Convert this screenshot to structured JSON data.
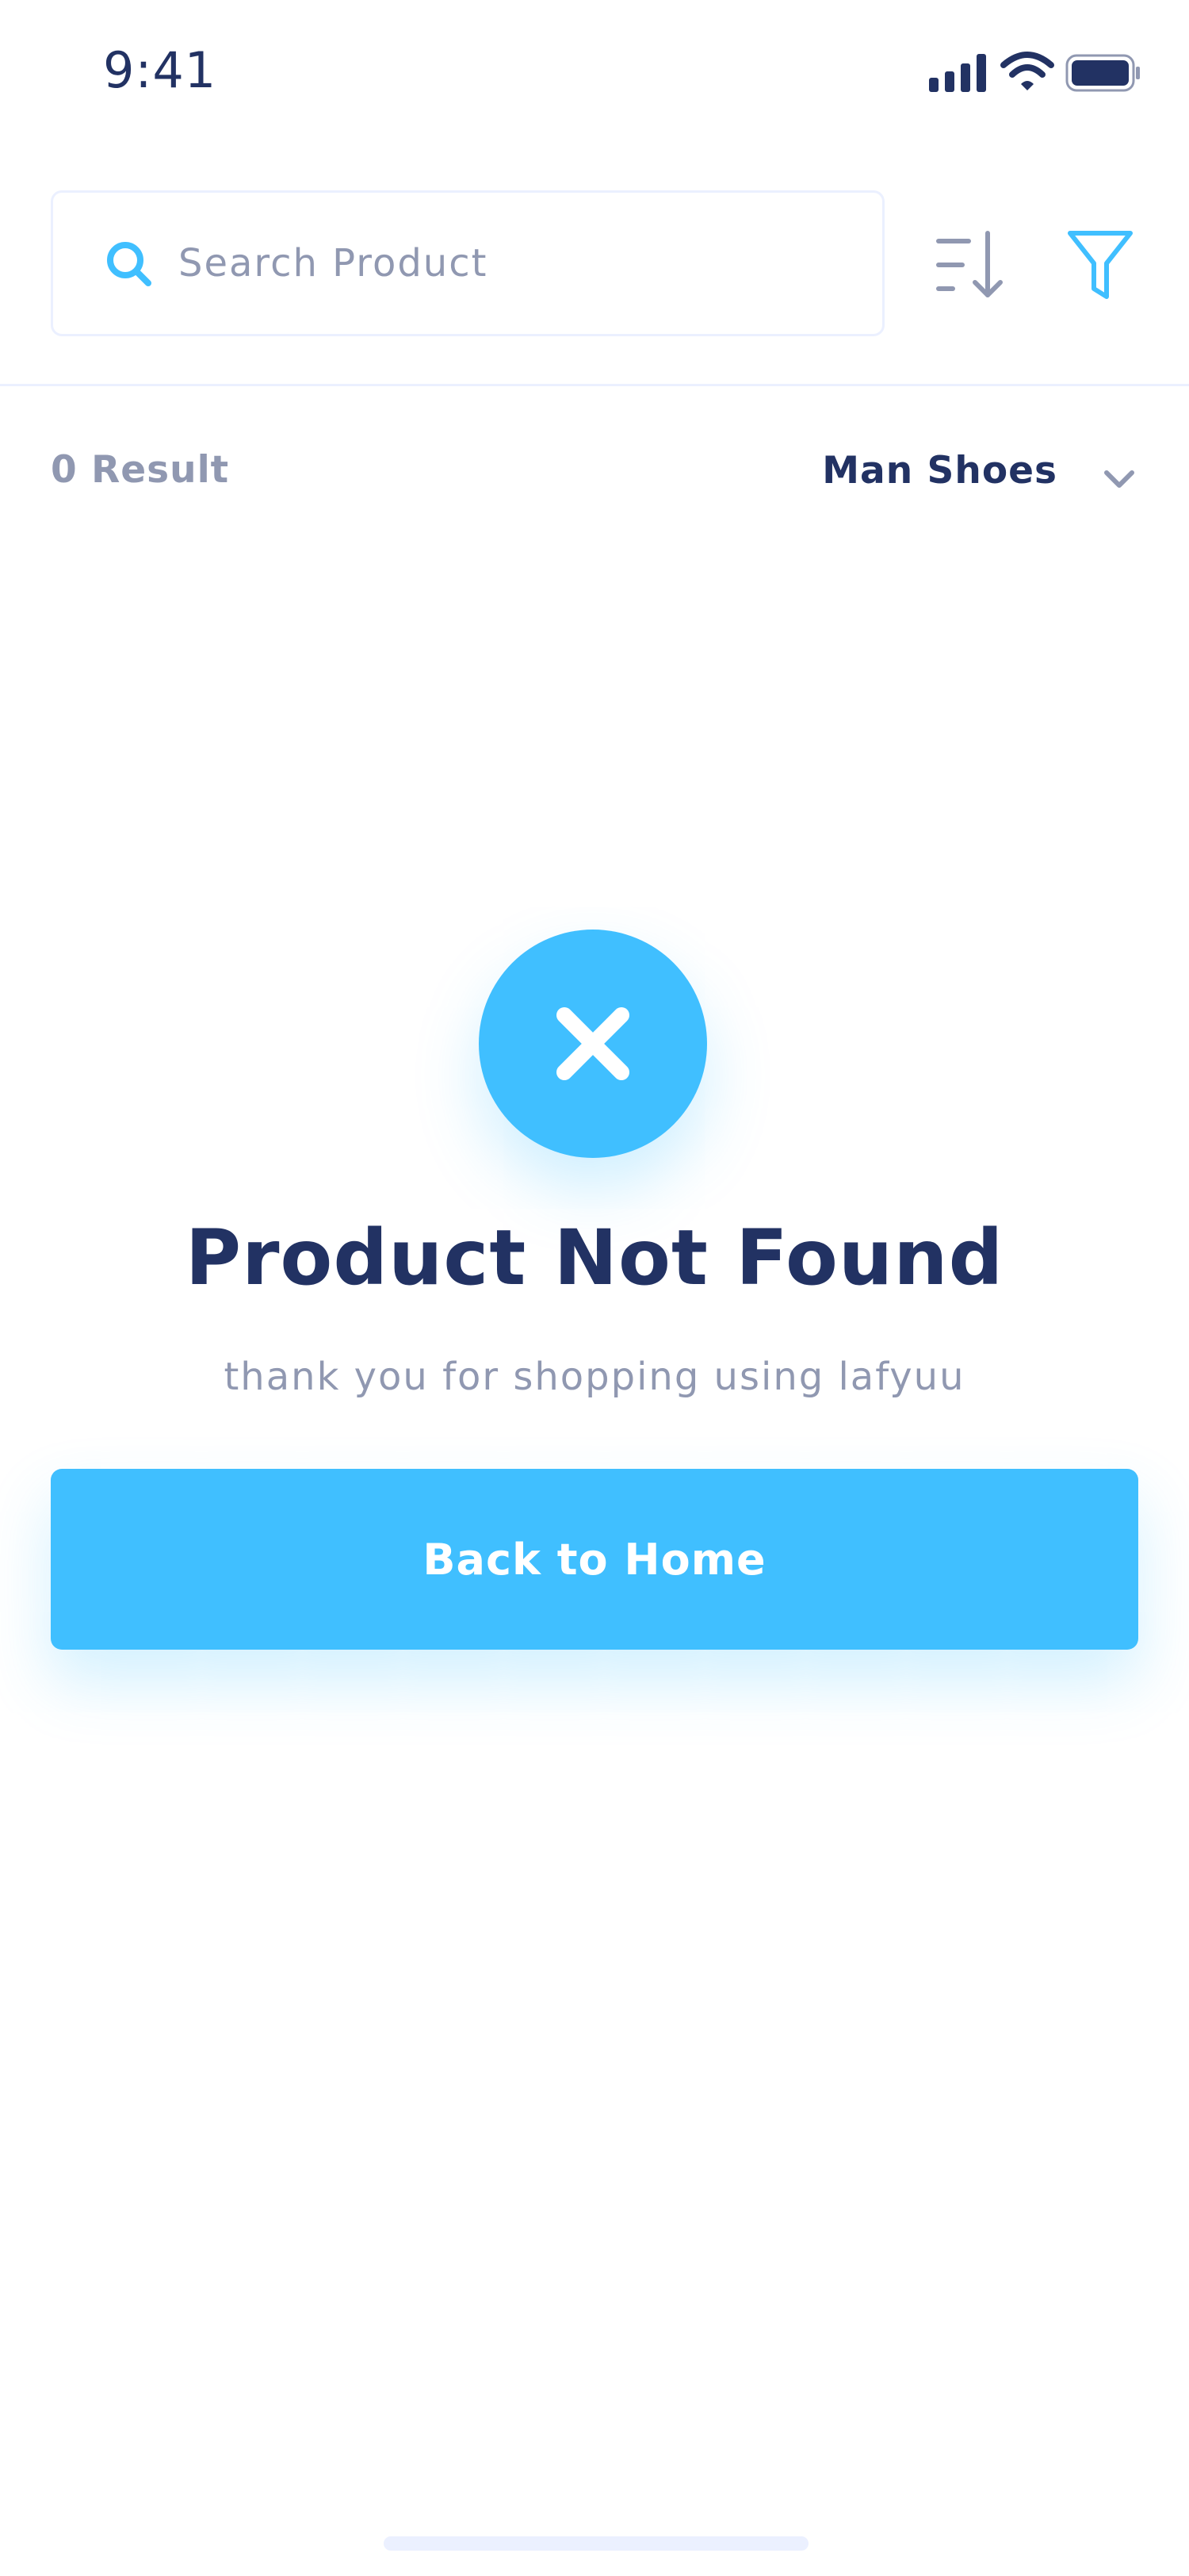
{
  "status_bar": {
    "time": "9:41",
    "icons": [
      "signal-icon",
      "wifi-icon",
      "battery-icon"
    ]
  },
  "search": {
    "value": "",
    "placeholder": "Search Product",
    "icon": "search-icon"
  },
  "toolbar": {
    "sort_icon": "sort-icon",
    "filter_icon": "filter-icon"
  },
  "results": {
    "count_label": "0 Result",
    "category": "Man Shoes",
    "category_icon": "chevron-down-icon"
  },
  "empty_state": {
    "icon": "close-icon",
    "title": "Product Not Found",
    "subtitle": "thank you for shopping using lafyuu",
    "button_label": "Back to Home"
  },
  "colors": {
    "primary": "#40bfff",
    "dark_text": "#223263",
    "muted_text": "#9098b1",
    "border": "#ebf0ff"
  }
}
